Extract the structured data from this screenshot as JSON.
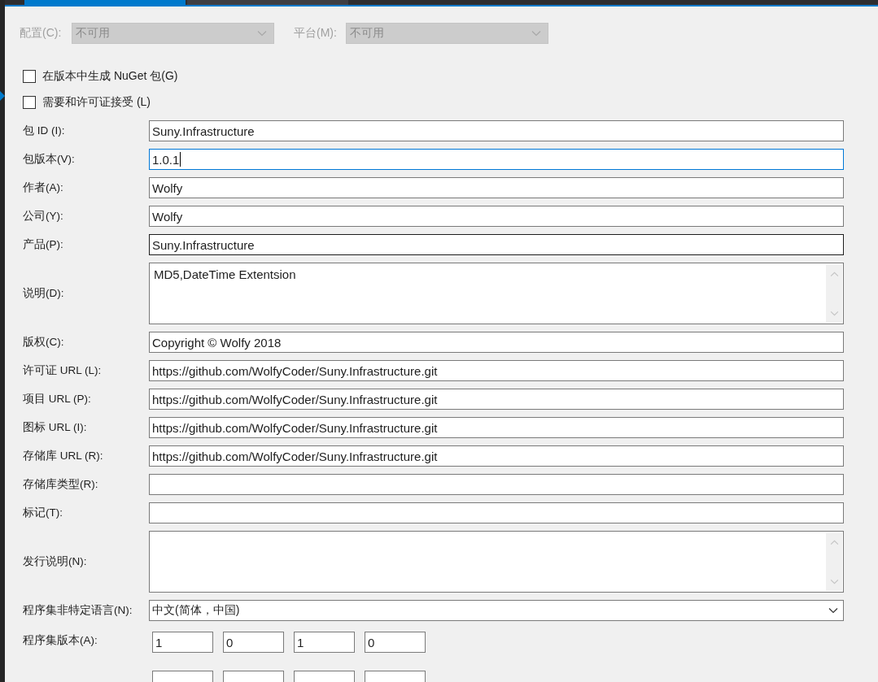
{
  "config_bar": [
    {
      "label": "配置(C):",
      "value": "不可用",
      "disabled": true
    },
    {
      "label": "平台(M):",
      "value": "不可用",
      "disabled": true
    }
  ],
  "checkboxes": [
    {
      "label": "在版本中生成 NuGet 包(G)",
      "checked": false
    },
    {
      "label": "需要和许可证接受 (L)",
      "checked": false
    }
  ],
  "fields": [
    {
      "kind": "text",
      "label": "包 ID (I):",
      "value": "Suny.Infrastructure",
      "focused": false,
      "hovered": false
    },
    {
      "kind": "text",
      "label": "包版本(V):",
      "value": "1.0.1",
      "focused": true,
      "hovered": false
    },
    {
      "kind": "text",
      "label": "作者(A):",
      "value": "Wolfy",
      "focused": false,
      "hovered": false
    },
    {
      "kind": "text",
      "label": "公司(Y):",
      "value": "Wolfy",
      "focused": false,
      "hovered": false
    },
    {
      "kind": "text",
      "label": "产品(P):",
      "value": "Suny.Infrastructure",
      "focused": false,
      "hovered": true
    },
    {
      "kind": "textarea",
      "label": "说明(D):",
      "value": "MD5,DateTime Extentsion",
      "focused": false,
      "hovered": false
    },
    {
      "kind": "text",
      "label": "版权(C):",
      "value": "Copyright © Wolfy 2018",
      "focused": false,
      "hovered": false
    },
    {
      "kind": "text",
      "label": "许可证 URL (L):",
      "value": "https://github.com/WolfyCoder/Suny.Infrastructure.git",
      "focused": false,
      "hovered": false
    },
    {
      "kind": "text",
      "label": "项目 URL (P):",
      "value": "https://github.com/WolfyCoder/Suny.Infrastructure.git",
      "focused": false,
      "hovered": false
    },
    {
      "kind": "text",
      "label": "图标 URL (I):",
      "value": "https://github.com/WolfyCoder/Suny.Infrastructure.git",
      "focused": false,
      "hovered": false
    },
    {
      "kind": "text",
      "label": "存储库 URL (R):",
      "value": "https://github.com/WolfyCoder/Suny.Infrastructure.git",
      "focused": false,
      "hovered": false
    },
    {
      "kind": "text",
      "label": "存储库类型(R):",
      "focused": false,
      "hovered": false
    },
    {
      "kind": "text",
      "label": "标记(T):",
      "focused": false,
      "hovered": false
    },
    {
      "kind": "textarea",
      "label": "发行说明(N):",
      "focused": false,
      "hovered": false
    },
    {
      "kind": "dropdown",
      "label": "程序集非特定语言(N):",
      "value": "中文(简体，中国)",
      "focused": false,
      "hovered": false
    },
    {
      "kind": "version",
      "label": "程序集版本(A):",
      "parts": [
        "1",
        "0",
        "1",
        "0"
      ]
    }
  ],
  "more_rows_below": true
}
